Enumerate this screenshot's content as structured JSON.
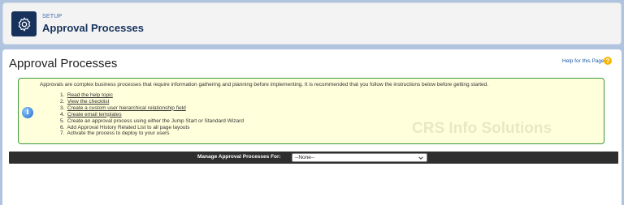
{
  "header": {
    "section_label": "SETUP",
    "title": "Approval Processes",
    "icon": "gear-icon"
  },
  "page": {
    "title": "Approval Processes",
    "help_link": "Help for this Page",
    "help_icon": "question-icon"
  },
  "info": {
    "icon": "info-icon",
    "intro": "Approvals are complex business processes that require information gathering and planning before implementing. It is recommended that you follow the instructions below before getting started.",
    "steps": [
      {
        "num": "1.",
        "text": "Read the help topic",
        "link": true
      },
      {
        "num": "2.",
        "text": "View the checklist",
        "link": true
      },
      {
        "num": "3.",
        "text": "Create a custom user hierarchical relationship field",
        "link": true
      },
      {
        "num": "4.",
        "text": "Create email templates",
        "link": true
      },
      {
        "num": "5.",
        "text": "Create an approval process using either the Jump Start or Standard Wizard",
        "link": false
      },
      {
        "num": "6.",
        "text": "Add Approval History Related List to all page layouts",
        "link": false
      },
      {
        "num": "7.",
        "text": "Activate the process to deploy to your users",
        "link": false
      }
    ],
    "watermark": "CRS Info Solutions"
  },
  "manage": {
    "label": "Manage Approval Processes For:",
    "selected": "--None--"
  },
  "colors": {
    "navy": "#16325c",
    "info_bg": "#ffffdc",
    "info_border": "#3b9a3b",
    "bar": "#2e2e2e",
    "help_orange": "#f7b500"
  }
}
